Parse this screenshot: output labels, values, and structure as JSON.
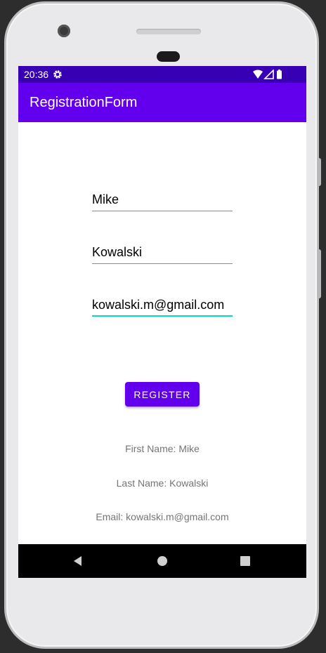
{
  "status_bar": {
    "time": "20:36",
    "icons": [
      "gear-icon",
      "wifi-icon",
      "signal-icon",
      "battery-icon"
    ]
  },
  "app_bar": {
    "title": "RegistrationForm",
    "color": "#6200ee",
    "status_color": "#3700b3"
  },
  "form": {
    "first_name": "Mike",
    "last_name": "Kowalski",
    "email": "kowalski.m@gmail.com",
    "focused_field": "email",
    "focus_color": "#03dac5"
  },
  "register_button": {
    "label": "REGISTER"
  },
  "results": {
    "first_name": "First Name: Mike",
    "last_name": "Last Name: Kowalski",
    "email": "Email: kowalski.m@gmail.com"
  },
  "nav_bar": {
    "buttons": [
      "back-icon",
      "home-icon",
      "recents-icon"
    ]
  }
}
